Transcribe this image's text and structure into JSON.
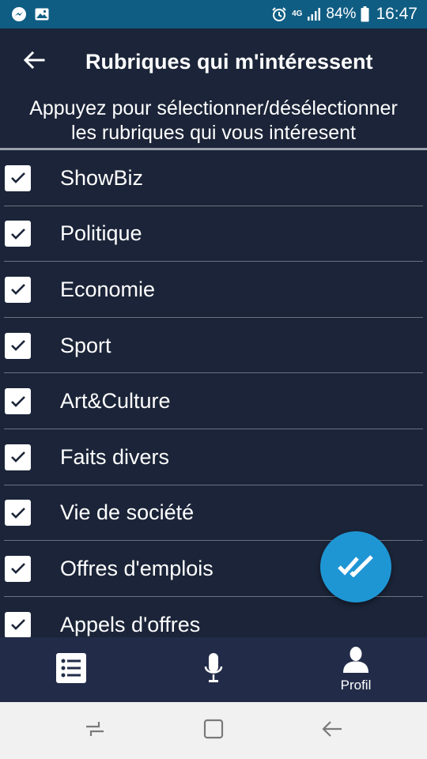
{
  "status_bar": {
    "network": "4G",
    "battery": "84%",
    "time": "16:47"
  },
  "app_bar": {
    "title": "Rubriques qui m'intéressent"
  },
  "instructions": {
    "line1": "Appuyez pour sélectionner/désélectionner",
    "line2": "les rubriques qui vous intéresent"
  },
  "categories": [
    {
      "label": "ShowBiz",
      "checked": true
    },
    {
      "label": "Politique",
      "checked": true
    },
    {
      "label": "Economie",
      "checked": true
    },
    {
      "label": "Sport",
      "checked": true
    },
    {
      "label": "Art&Culture",
      "checked": true
    },
    {
      "label": "Faits divers",
      "checked": true
    },
    {
      "label": "Vie de société",
      "checked": true
    },
    {
      "label": "Offres d'emplois",
      "checked": true
    },
    {
      "label": "Appels d'offres",
      "checked": true
    }
  ],
  "bottom_nav": {
    "items": [
      {
        "icon": "list-icon"
      },
      {
        "icon": "microphone-icon"
      },
      {
        "icon": "profile-icon",
        "label": "Profil"
      }
    ]
  },
  "colors": {
    "background": "#1b2438",
    "status_bar": "#0f5d83",
    "accent": "#1f96d4",
    "bottom_nav": "#222c49",
    "system_nav": "#f1f1f1"
  }
}
